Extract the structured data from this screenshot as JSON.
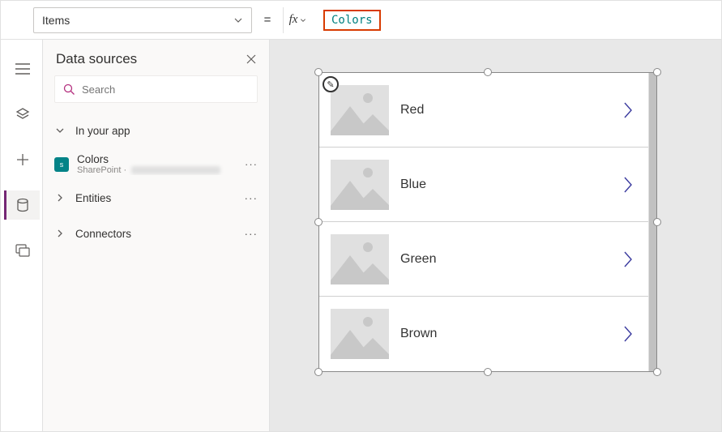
{
  "formula_bar": {
    "property": "Items",
    "equals": "=",
    "fx_label": "fx",
    "value": "Colors"
  },
  "panel": {
    "title": "Data sources",
    "search_placeholder": "Search",
    "sections": {
      "in_app": "In your app",
      "entities": "Entities",
      "connectors": "Connectors"
    },
    "datasource": {
      "name": "Colors",
      "connector": "SharePoint",
      "separator": " · "
    }
  },
  "gallery": {
    "items": [
      {
        "title": "Red"
      },
      {
        "title": "Blue"
      },
      {
        "title": "Green"
      },
      {
        "title": "Brown"
      }
    ]
  },
  "colors": {
    "highlight_border": "#d83b01",
    "formula_text": "#008080",
    "accent": "#742774"
  }
}
